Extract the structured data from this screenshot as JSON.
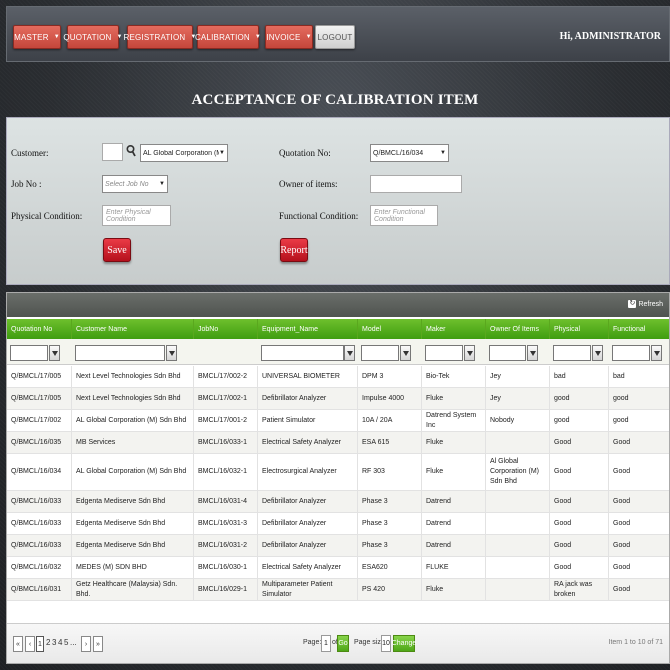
{
  "nav": {
    "items": [
      {
        "label": "MASTER"
      },
      {
        "label": "QUOTATION"
      },
      {
        "label": "REGISTRATION"
      },
      {
        "label": "CALIBRATION"
      },
      {
        "label": "INVOICE"
      }
    ],
    "logout_label": "LOGOUT",
    "greeting": "Hi, ADMINISTRATOR"
  },
  "page_title": "ACCEPTANCE OF CALIBRATION ITEM",
  "form": {
    "customer_label": "Customer:",
    "customer_code": "",
    "customer_selected": "AL Global Corporation (M) Sdn Bhd",
    "job_no_label": "Job No :",
    "job_no_placeholder": "Select Job No",
    "physical_label": "Physical Condition:",
    "physical_placeholder": "Enter Physical Condition",
    "save_label": "Save",
    "quotation_label": "Quotation No:",
    "quotation_selected": "Q/BMCL/16/034",
    "owner_label": "Owner of items:",
    "owner_value": "",
    "functional_label": "Functional Condition:",
    "functional_placeholder": "Enter Functional Condition",
    "report_label": "Report"
  },
  "grid": {
    "refresh_label": "Refresh",
    "columns": [
      "Quotation No",
      "Customer Name",
      "JobNo",
      "Equipment_Name",
      "Model",
      "Maker",
      "Owner Of Items",
      "Physical",
      "Functional"
    ],
    "rows": [
      [
        "Q/BMCL/17/005",
        "Next Level Technologies Sdn Bhd",
        "BMCL/17/002-2",
        "UNIVERSAL BIOMETER",
        "DPM 3",
        "Bio-Tek",
        "Jey",
        "bad",
        "bad"
      ],
      [
        "Q/BMCL/17/005",
        "Next Level Technologies Sdn Bhd",
        "BMCL/17/002-1",
        "Defibrillator Analyzer",
        "Impulse 4000",
        "Fluke",
        "Jey",
        "good",
        "good"
      ],
      [
        "Q/BMCL/17/002",
        "AL Global Corporation (M) Sdn Bhd",
        "BMCL/17/001-2",
        "Patient Simulator",
        "10A / 20A",
        "Datrend System Inc",
        "Nobody",
        "good",
        "good"
      ],
      [
        "Q/BMCL/16/035",
        "MB Services",
        "BMCL/16/033-1",
        "Electrical Safety Analyzer",
        "ESA 615",
        "Fluke",
        "",
        "Good",
        "Good"
      ],
      [
        "Q/BMCL/16/034",
        "AL Global Corporation (M) Sdn Bhd",
        "BMCL/16/032-1",
        "Electrosurgical Analyzer",
        "RF 303",
        "Fluke",
        "Al Global Corporation (M) Sdn Bhd",
        "Good",
        "Good"
      ],
      [
        "Q/BMCL/16/033",
        "Edgenta Mediserve Sdn Bhd",
        "BMCL/16/031-4",
        "Defibrillator Analyzer",
        "Phase 3",
        "Datrend",
        "",
        "Good",
        "Good"
      ],
      [
        "Q/BMCL/16/033",
        "Edgenta Mediserve Sdn Bhd",
        "BMCL/16/031-3",
        "Defibrillator Analyzer",
        "Phase 3",
        "Datrend",
        "",
        "Good",
        "Good"
      ],
      [
        "Q/BMCL/16/033",
        "Edgenta Mediserve Sdn Bhd",
        "BMCL/16/031-2",
        "Defibrillator Analyzer",
        "Phase 3",
        "Datrend",
        "",
        "Good",
        "Good"
      ],
      [
        "Q/BMCL/16/032",
        "MEDES (M) SDN BHD",
        "BMCL/16/030-1",
        "Electrical Safety Analyzer",
        "ESA620",
        "FLUKE",
        "",
        "Good",
        "Good"
      ],
      [
        "Q/BMCL/16/031",
        "Getz Healthcare (Malaysia) Sdn. Bhd.",
        "BMCL/16/029-1",
        "Multiparameter Patient Simulator",
        "PS 420",
        "Fluke",
        "",
        "RA jack was broken",
        "Good"
      ]
    ]
  },
  "pager": {
    "pages": [
      "1",
      "2",
      "3",
      "4",
      "5",
      "..."
    ],
    "page_label": "Page:",
    "page_value": "1",
    "of_label": "of 8",
    "go_label": "Go",
    "page_size_label": "Page size:",
    "page_size_value": "10",
    "change_label": "Change",
    "summary": "Item 1 to 10 of 71"
  }
}
